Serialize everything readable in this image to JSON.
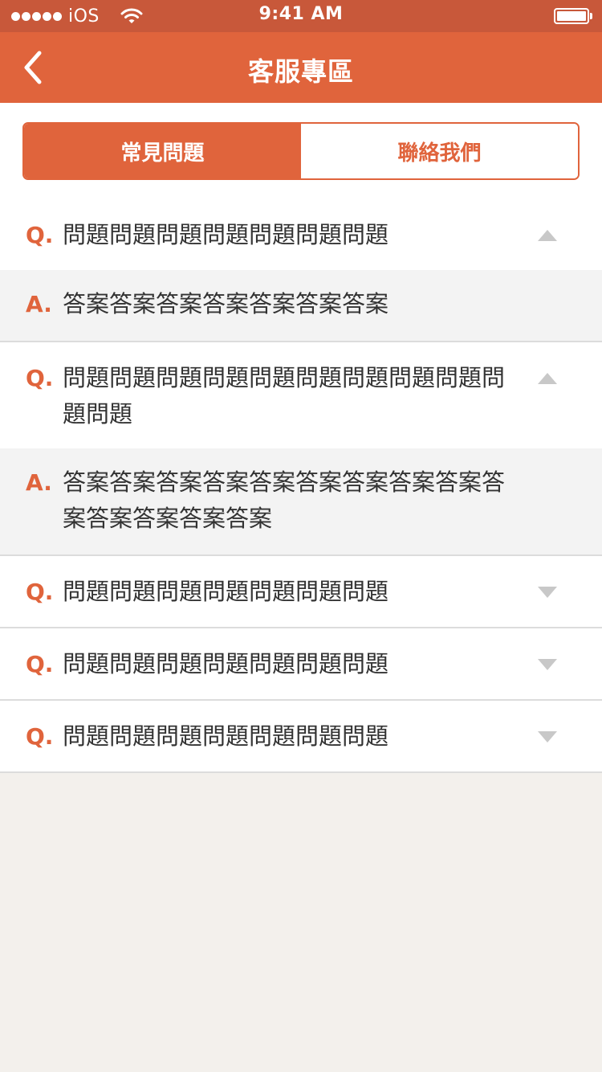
{
  "status_bar": {
    "carrier": "iOS",
    "time": "9:41 AM",
    "signal_icon": "signal-dots-icon",
    "wifi_icon": "wifi-icon",
    "battery_icon": "battery-icon",
    "battery_level": 1.0
  },
  "nav": {
    "title": "客服專區",
    "back_icon": "chevron-left-icon"
  },
  "segments": {
    "faq_label": "常見問題",
    "contact_label": "聯絡我們",
    "active": "faq"
  },
  "faq": {
    "q_marker": "Q.",
    "a_marker": "A.",
    "items": [
      {
        "question": "問題問題問題問題問題問題問題",
        "answer": "答案答案答案答案答案答案答案",
        "expanded": true
      },
      {
        "question": "問題問題問題問題問題問題問題問題問題問題問題",
        "answer": "答案答案答案答案答案答案答案答案答案答案答案答案答案答案",
        "expanded": true
      },
      {
        "question": "問題問題問題問題問題問題問題",
        "expanded": false
      },
      {
        "question": "問題問題問題問題問題問題問題",
        "expanded": false
      },
      {
        "question": "問題問題問題問題問題問題問題",
        "expanded": false
      }
    ]
  },
  "colors": {
    "status_bar": "#c8583a",
    "accent": "#e0643c",
    "page_background": "#f3f0ec",
    "answer_background": "#f3f3f3",
    "arrow": "#c8c8c8",
    "divider": "#dcdcdc",
    "text": "#333333"
  }
}
